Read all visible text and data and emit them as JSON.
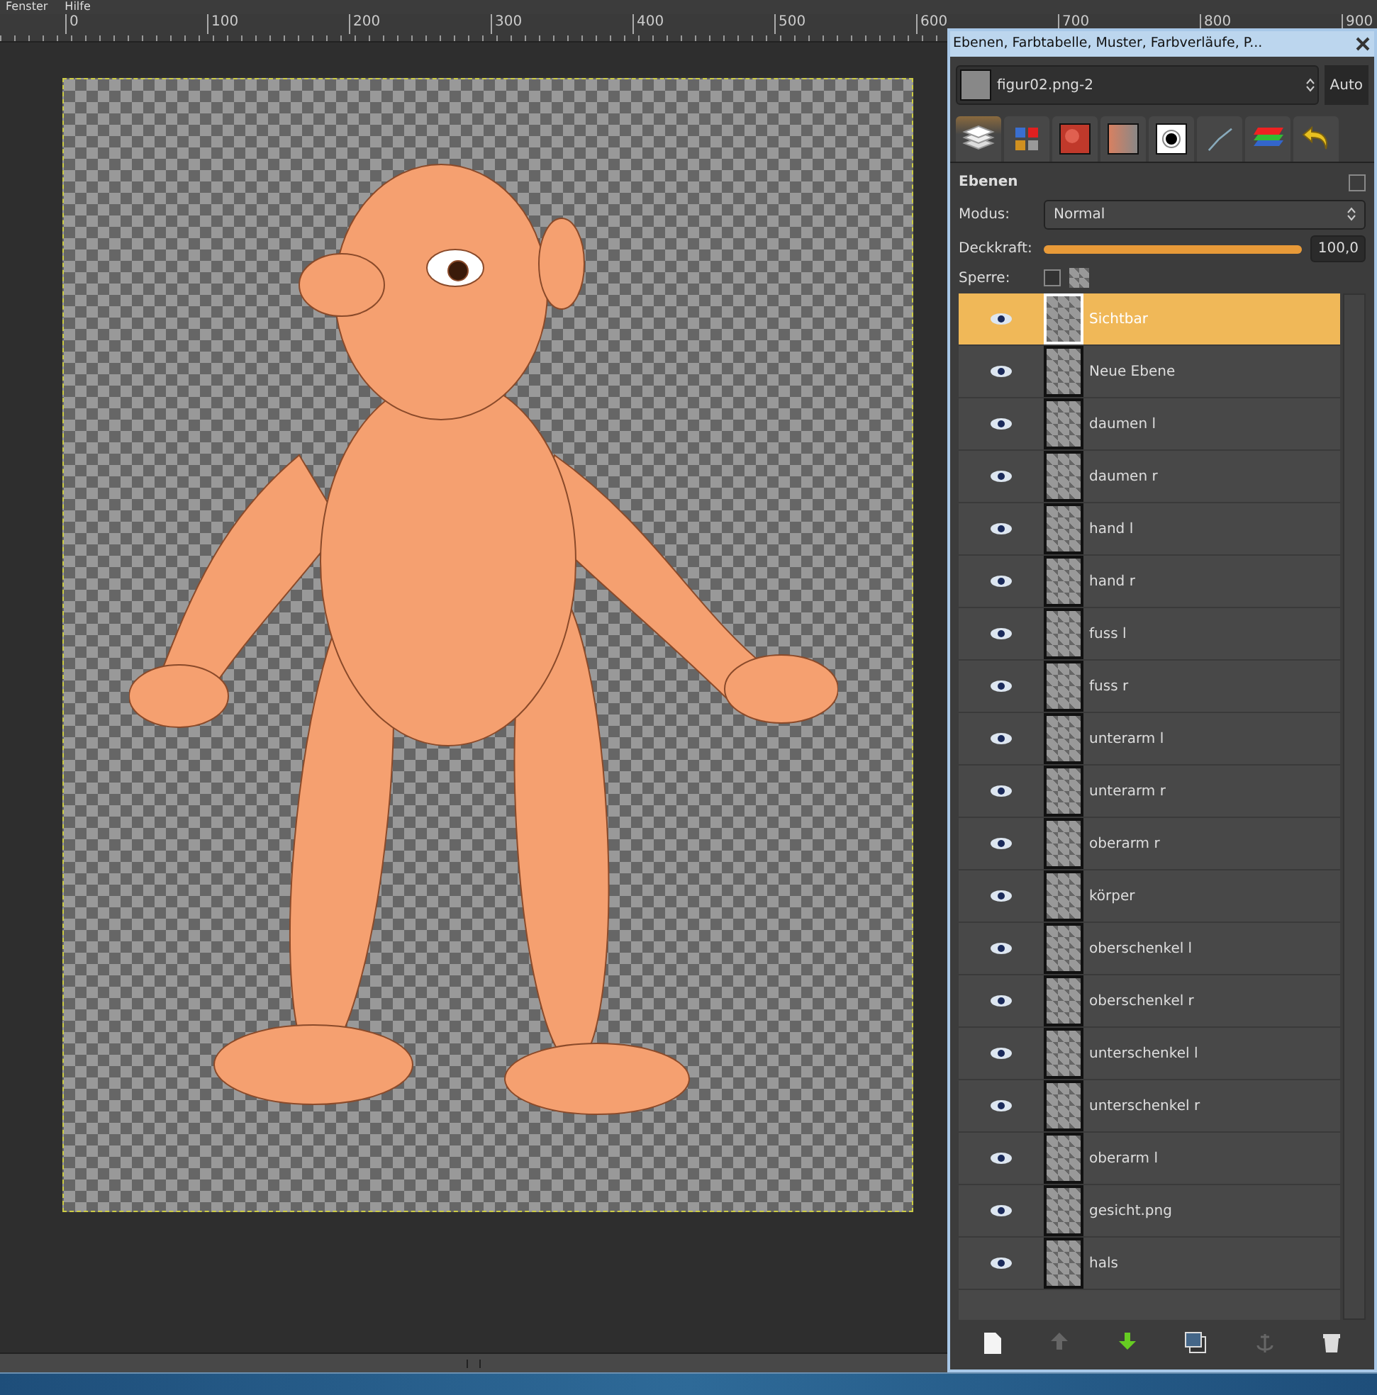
{
  "menubar": [
    "Fenster",
    "Hilfe"
  ],
  "ruler": [
    "0",
    "100",
    "200",
    "300",
    "400",
    "500",
    "600",
    "700",
    "800",
    "900"
  ],
  "dock": {
    "title": "Ebenen, Farbtabelle, Muster, Farbverläufe, P...",
    "image": "figur02.png-2",
    "auto": "Auto",
    "tabs": [
      {
        "kind": "layers",
        "selected": true
      },
      {
        "kind": "colormap",
        "selected": false
      },
      {
        "kind": "pattern",
        "selected": false
      },
      {
        "kind": "gradient",
        "selected": false
      },
      {
        "kind": "brush",
        "selected": false
      },
      {
        "kind": "paths",
        "selected": false
      },
      {
        "kind": "channels",
        "selected": false
      },
      {
        "kind": "undo",
        "selected": false
      }
    ],
    "section": "Ebenen",
    "mode_label": "Modus:",
    "mode": "Normal",
    "opacity_label": "Deckkraft:",
    "opacity": {
      "level": 1,
      "reading": "100,0"
    },
    "lock_label": "Sperre:",
    "lock_checked": false,
    "layers": [
      {
        "name": "Sichtbar",
        "visible": true,
        "selected": true
      },
      {
        "name": "Neue Ebene",
        "visible": true,
        "selected": false
      },
      {
        "name": "daumen l",
        "visible": true,
        "selected": false
      },
      {
        "name": "daumen r",
        "visible": true,
        "selected": false
      },
      {
        "name": "hand l",
        "visible": true,
        "selected": false
      },
      {
        "name": "hand r",
        "visible": true,
        "selected": false
      },
      {
        "name": "fuss l",
        "visible": true,
        "selected": false
      },
      {
        "name": "fuss r",
        "visible": true,
        "selected": false
      },
      {
        "name": "unterarm l",
        "visible": true,
        "selected": false
      },
      {
        "name": "unterarm r",
        "visible": true,
        "selected": false
      },
      {
        "name": "oberarm r",
        "visible": true,
        "selected": false
      },
      {
        "name": "körper",
        "visible": true,
        "selected": false
      },
      {
        "name": "oberschenkel l",
        "visible": true,
        "selected": false
      },
      {
        "name": "oberschenkel r",
        "visible": true,
        "selected": false
      },
      {
        "name": "unterschenkel l",
        "visible": true,
        "selected": false
      },
      {
        "name": "unterschenkel r",
        "visible": true,
        "selected": false
      },
      {
        "name": "oberarm l",
        "visible": true,
        "selected": false
      },
      {
        "name": "gesicht.png",
        "visible": true,
        "selected": false
      },
      {
        "name": "hals",
        "visible": true,
        "selected": false
      }
    ],
    "buttons": [
      {
        "kind": "new",
        "disabled": false
      },
      {
        "kind": "raise",
        "disabled": true
      },
      {
        "kind": "lower",
        "disabled": false
      },
      {
        "kind": "duplicate",
        "disabled": false
      },
      {
        "kind": "anchor",
        "disabled": true
      },
      {
        "kind": "delete",
        "disabled": false
      }
    ]
  }
}
